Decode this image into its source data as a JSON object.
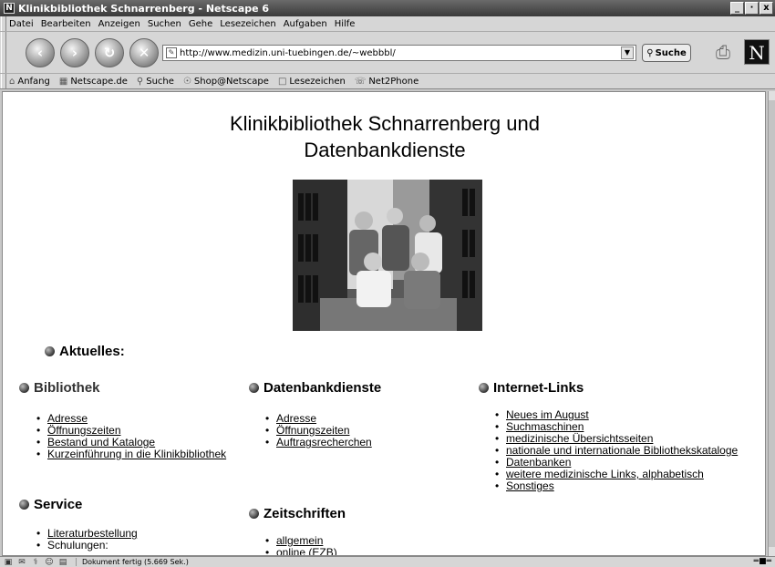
{
  "window": {
    "title": "Klinikbibliothek Schnarrenberg - Netscape 6",
    "app_icon": "N",
    "buttons": [
      "_",
      "·",
      "x"
    ]
  },
  "menu": {
    "items": [
      "Datei",
      "Bearbeiten",
      "Anzeigen",
      "Suchen",
      "Gehe",
      "Lesezeichen",
      "Aufgaben",
      "Hilfe"
    ]
  },
  "navbar": {
    "url": "http://www.medizin.uni-tuebingen.de/~webbbl/",
    "search_label": "Suche",
    "logo_letter": "N"
  },
  "personal_toolbar": {
    "items": [
      {
        "icon": "home-icon",
        "label": "Anfang"
      },
      {
        "icon": "my-netscape-icon",
        "label": "Netscape.de"
      },
      {
        "icon": "search-icon",
        "label": "Suche"
      },
      {
        "icon": "shop-icon",
        "label": "Shop@Netscape"
      },
      {
        "icon": "bookmarks-icon",
        "label": "Lesezeichen"
      },
      {
        "icon": "net2phone-icon",
        "label": "Net2Phone"
      }
    ]
  },
  "page": {
    "title_line1": "Klinikbibliothek Schnarrenberg und",
    "title_line2": "Datenbankdienste",
    "photo_alt": "Team photo",
    "aktuelles": "Aktuelles:",
    "bibliothek": {
      "heading": "Bibliothek",
      "links": [
        "Adresse",
        "Öffnungszeiten",
        "Bestand und Kataloge",
        "Kurzeinführung in die Klinikbibliothek"
      ]
    },
    "datenbankdienste": {
      "heading": "Datenbankdienste",
      "links": [
        "Adresse",
        "Öffnungszeiten",
        "Auftragsrecherchen"
      ]
    },
    "internet_links": {
      "heading": "Internet-Links",
      "links": [
        "Neues im August",
        "Suchmaschinen",
        "medizinische Übersichtsseiten",
        "nationale und internationale Bibliothekskataloge",
        "Datenbanken",
        "weitere medizinische Links, alphabetisch",
        "Sonstiges"
      ]
    },
    "service": {
      "heading": "Service",
      "items": [
        {
          "text": "Literaturbestellung",
          "link": true
        },
        {
          "text": "Schulungen:",
          "link": false
        }
      ]
    },
    "zeitschriften": {
      "heading": "Zeitschriften",
      "links": [
        "allgemein",
        "online (EZB)"
      ]
    }
  },
  "status": {
    "text": "Dokument fertig (5.669 Sek.)"
  }
}
